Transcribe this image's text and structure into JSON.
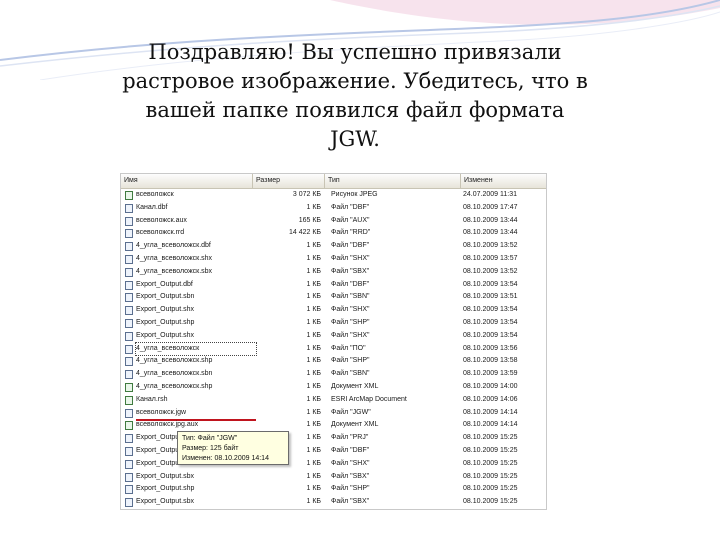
{
  "slide": {
    "text": "Поздравляю! Вы успешно привязали растровое изображение. Убедитесь, что в вашей папке появился файл формата JGW."
  },
  "explorer": {
    "columns": {
      "name": "Имя",
      "size": "Размер",
      "type": "Тип",
      "date": "Изменен"
    },
    "rows": [
      {
        "name": "всеволожск",
        "size": "3 072 КБ",
        "type": "Рисунок JPEG",
        "date": "24.07.2009 11:31"
      },
      {
        "name": "Канал.dbf",
        "size": "1 КБ",
        "type": "Файл \"DBF\"",
        "date": "08.10.2009 17:47"
      },
      {
        "name": "всеволожск.aux",
        "size": "165 КБ",
        "type": "Файл \"AUX\"",
        "date": "08.10.2009 13:44"
      },
      {
        "name": "всеволожск.rrd",
        "size": "14 422 КБ",
        "type": "Файл \"RRD\"",
        "date": "08.10.2009 13:44"
      },
      {
        "name": "4_угла_всеволожск.dbf",
        "size": "1 КБ",
        "type": "Файл \"DBF\"",
        "date": "08.10.2009 13:52"
      },
      {
        "name": "4_угла_всеволожск.shx",
        "size": "1 КБ",
        "type": "Файл \"SHX\"",
        "date": "08.10.2009 13:57"
      },
      {
        "name": "4_угла_всеволожск.sbx",
        "size": "1 КБ",
        "type": "Файл \"SBX\"",
        "date": "08.10.2009 13:52"
      },
      {
        "name": "Export_Output.dbf",
        "size": "1 КБ",
        "type": "Файл \"DBF\"",
        "date": "08.10.2009 13:54"
      },
      {
        "name": "Export_Output.sbn",
        "size": "1 КБ",
        "type": "Файл \"SBN\"",
        "date": "08.10.2009 13:51"
      },
      {
        "name": "Export_Output.shx",
        "size": "1 КБ",
        "type": "Файл \"SHX\"",
        "date": "08.10.2009 13:54"
      },
      {
        "name": "Export_Output.shp",
        "size": "1 КБ",
        "type": "Файл \"SHP\"",
        "date": "08.10.2009 13:54"
      },
      {
        "name": "Export_Output.shx",
        "size": "1 КБ",
        "type": "Файл \"SHX\"",
        "date": "08.10.2009 13:54"
      },
      {
        "name": "4_угла_всеволожск",
        "size": "1 КБ",
        "type": "Файл \"ПО\"",
        "date": "08.10.2009 13:56"
      },
      {
        "name": "4_угла_всеволожск.shp",
        "size": "1 КБ",
        "type": "Файл \"SHP\"",
        "date": "08.10.2009 13:58"
      },
      {
        "name": "4_угла_всеволожск.sbn",
        "size": "1 КБ",
        "type": "Файл \"SBN\"",
        "date": "08.10.2009 13:59"
      },
      {
        "name": "4_угла_всеволожск.shp",
        "size": "1 КБ",
        "type": "Документ XML",
        "date": "08.10.2009 14:00"
      },
      {
        "name": "Канал.rsh",
        "size": "1 КБ",
        "type": "ESRI ArcMap Document",
        "date": "08.10.2009 14:06"
      },
      {
        "name": "всеволожск.jgw",
        "size": "1 КБ",
        "type": "Файл \"JGW\"",
        "date": "08.10.2009 14:14"
      },
      {
        "name": "всеволожск.jpg.aux",
        "size": "1 КБ",
        "type": "Документ XML",
        "date": "08.10.2009 14:14"
      },
      {
        "name": "Export_Output.prj",
        "size": "1 КБ",
        "type": "Файл \"PRJ\"",
        "date": "08.10.2009 15:25"
      },
      {
        "name": "Export_Output.dbf",
        "size": "1 КБ",
        "type": "Файл \"DBF\"",
        "date": "08.10.2009 15:25"
      },
      {
        "name": "Export_Output.shx",
        "size": "1 КБ",
        "type": "Файл \"SHX\"",
        "date": "08.10.2009 15:25"
      },
      {
        "name": "Export_Output.sbx",
        "size": "1 КБ",
        "type": "Файл \"SBX\"",
        "date": "08.10.2009 15:25"
      },
      {
        "name": "Export_Output.shp",
        "size": "1 КБ",
        "type": "Файл \"SHP\"",
        "date": "08.10.2009 15:25"
      },
      {
        "name": "Export_Output.sbx",
        "size": "1 КБ",
        "type": "Файл \"SBX\"",
        "date": "08.10.2009 15:25"
      }
    ],
    "tooltip": {
      "line1": "Тип: Файл \"JGW\"",
      "line2": "Размер: 125 байт",
      "line3": "Изменен: 08.10.2009 14:14"
    }
  }
}
